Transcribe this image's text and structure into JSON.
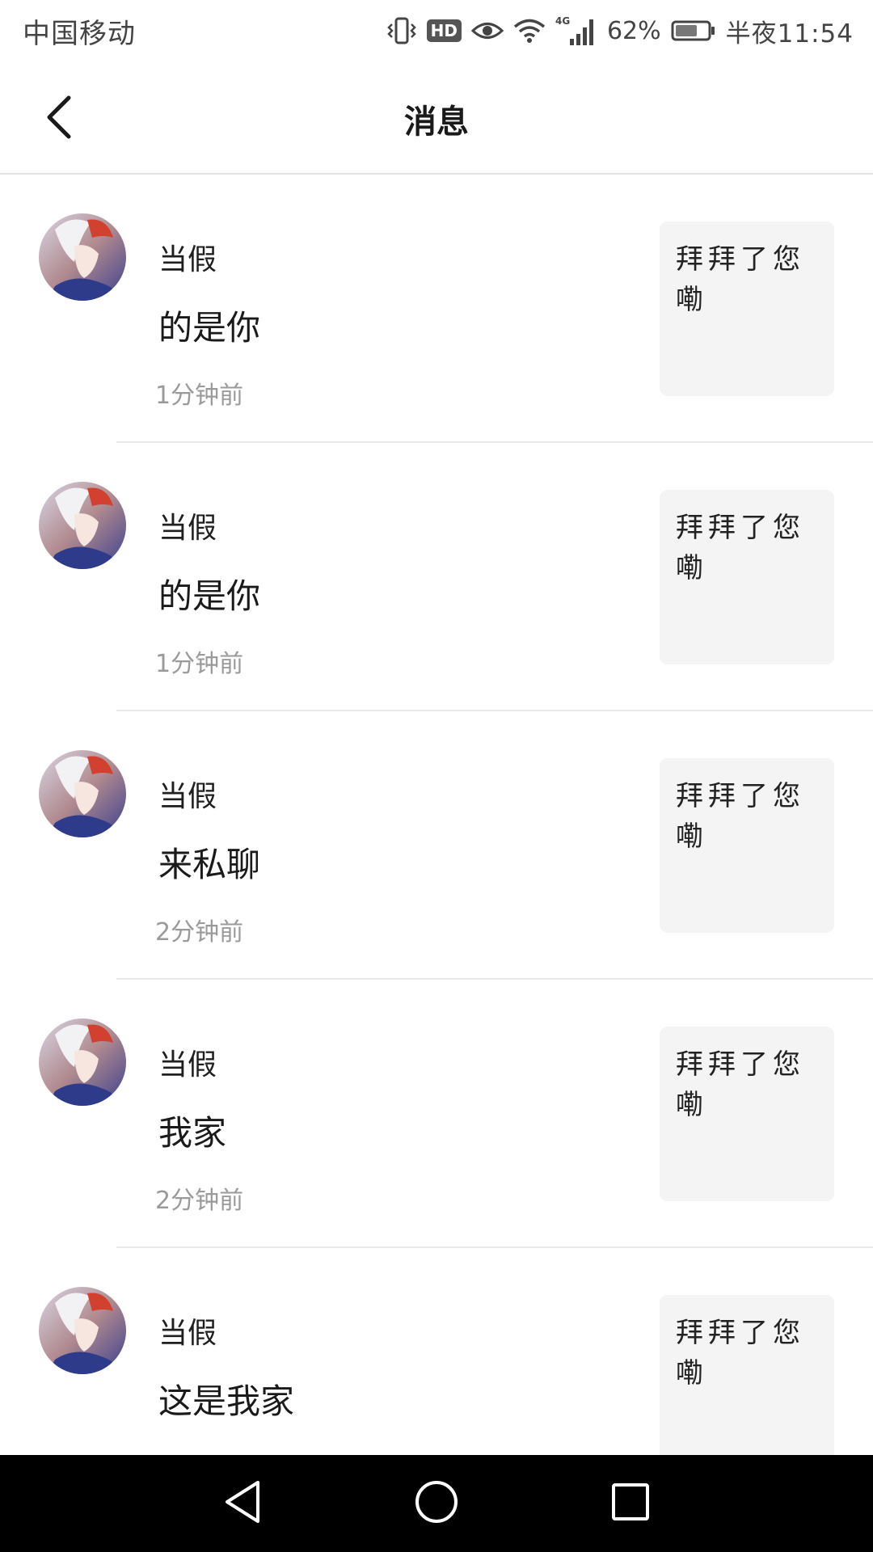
{
  "status_bar": {
    "carrier": "中国移动",
    "network": "4G",
    "battery_percent": "62%",
    "time": "半夜11:54",
    "icons": [
      "vibrate-icon",
      "hd-icon",
      "eye-icon",
      "wifi-icon",
      "signal-icon",
      "battery-icon"
    ],
    "hd_label": "HD"
  },
  "header": {
    "title": "消息",
    "back_icon": "chevron-left-icon"
  },
  "messages": [
    {
      "sender": "当假",
      "text": "的是你",
      "time": "1分钟前",
      "preview": "拜拜了您嘞"
    },
    {
      "sender": "当假",
      "text": "的是你",
      "time": "1分钟前",
      "preview": "拜拜了您嘞"
    },
    {
      "sender": "当假",
      "text": "来私聊",
      "time": "2分钟前",
      "preview": "拜拜了您嘞"
    },
    {
      "sender": "当假",
      "text": "我家",
      "time": "2分钟前",
      "preview": "拜拜了您嘞"
    },
    {
      "sender": "当假",
      "text": "这是我家",
      "time": "",
      "preview": "拜拜了您嘞"
    }
  ],
  "nav_bar": {
    "icons": [
      "back-triangle-icon",
      "home-circle-icon",
      "recents-square-icon"
    ]
  },
  "colors": {
    "text_primary": "#1a1a1a",
    "text_secondary": "#9a9a9a",
    "card_bg": "#f4f4f4",
    "divider": "#e8e8e8",
    "nav_bar_bg": "#000000"
  }
}
